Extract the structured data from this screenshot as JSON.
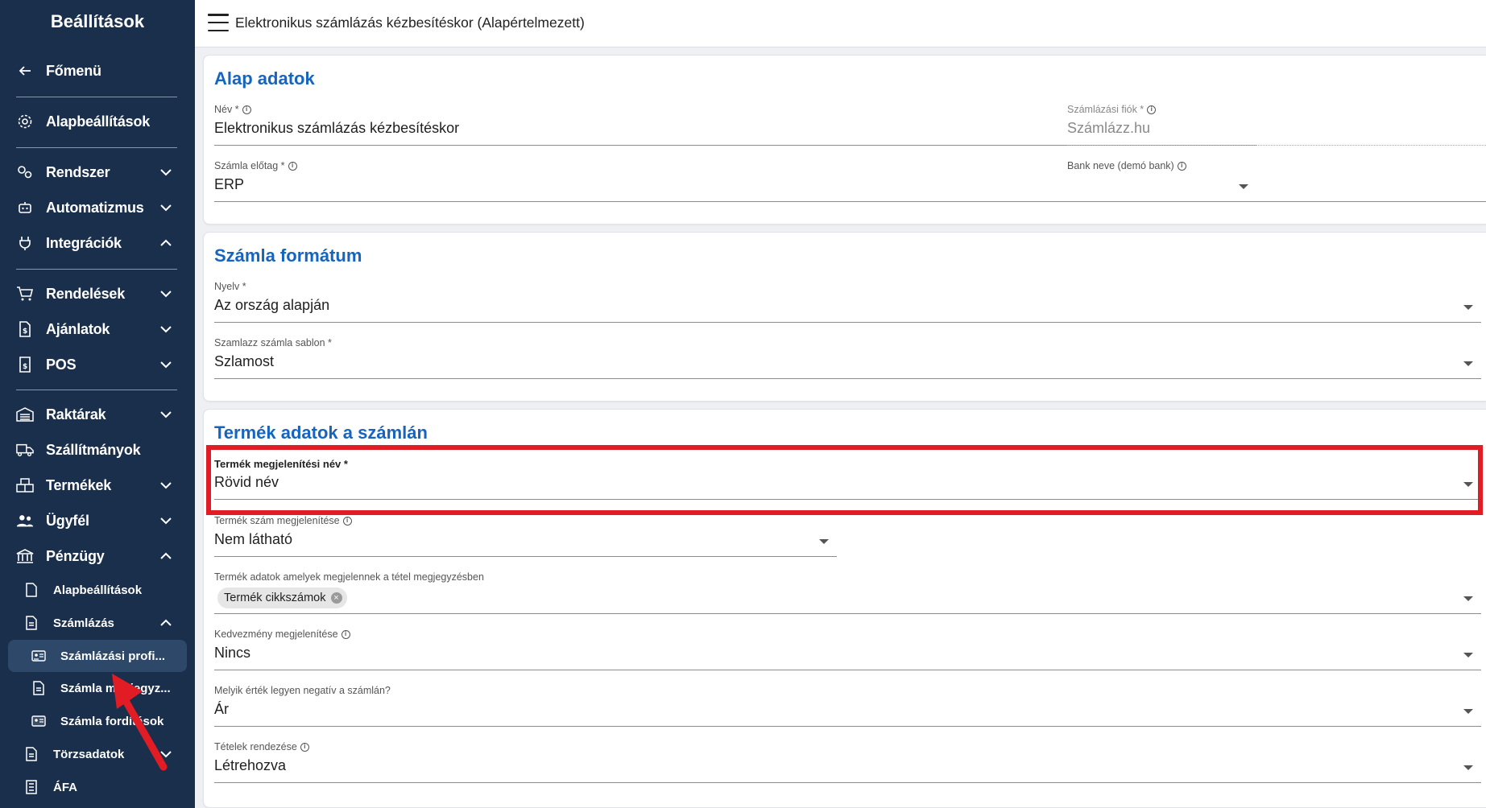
{
  "sidebar": {
    "title": "Beállítások",
    "back": "Főmenü",
    "items": [
      {
        "label": "Alapbeállítások",
        "icon": "gear-icon"
      },
      {
        "label": "Rendszer",
        "icon": "gears-icon"
      },
      {
        "label": "Automatizmus",
        "icon": "robot-icon"
      },
      {
        "label": "Integrációk",
        "icon": "plug-icon"
      },
      {
        "label": "Rendelések",
        "icon": "cart-icon"
      },
      {
        "label": "Ajánlatok",
        "icon": "offer-icon"
      },
      {
        "label": "POS",
        "icon": "pos-icon"
      },
      {
        "label": "Raktárak",
        "icon": "warehouse-icon"
      },
      {
        "label": "Szállítmányok",
        "icon": "truck-icon"
      },
      {
        "label": "Termékek",
        "icon": "boxes-icon"
      },
      {
        "label": "Ügyfél",
        "icon": "users-icon"
      },
      {
        "label": "Pénzügy",
        "icon": "bank-icon"
      }
    ],
    "finance_sub": {
      "basic": "Alapbeállítások",
      "invoicing": "Számlázás",
      "profiles": "Számlázási profi...",
      "notes": "Számla megjegyz...",
      "translations": "Számla fordítások",
      "master_data": "Törzsadatok",
      "vat": "ÁFA"
    }
  },
  "header": {
    "title": "Elektronikus számlázás kézbesítéskor (Alapértelmezett)"
  },
  "basic": {
    "title": "Alap adatok",
    "name_label": "Név *",
    "name_value": "Elektronikus számlázás kézbesítéskor",
    "account_label": "Számlázási fiók *",
    "account_value": "Számlázz.hu",
    "prefix_label": "Számla előtag *",
    "prefix_value": "ERP",
    "bank_label": "Bank neve (demó bank)",
    "bank_value": ""
  },
  "format": {
    "title": "Számla formátum",
    "lang_label": "Nyelv *",
    "lang_value": "Az ország alapján",
    "template_label": "Szamlazz számla sablon *",
    "template_value": "Szlamost"
  },
  "product": {
    "title": "Termék adatok a számlán",
    "display_name_label": "Termék megjelenítési név *",
    "display_name_value": "Rövid név",
    "number_label": "Termék szám megjelenítése",
    "number_value": "Nem látható",
    "notes_label": "Termék adatok amelyek megjelennek a tétel megjegyzésben",
    "notes_chip": "Termék cikkszámok",
    "discount_label": "Kedvezmény megjelenítése",
    "discount_value": "Nincs",
    "negative_label": "Melyik érték legyen negatív a számlán?",
    "negative_value": "Ár",
    "sort_label": "Tételek rendezése",
    "sort_value": "Létrehozva"
  },
  "colors": {
    "sidebar_bg": "#1a2f4b",
    "accent": "#1565c0",
    "highlight": "#e21c24"
  }
}
